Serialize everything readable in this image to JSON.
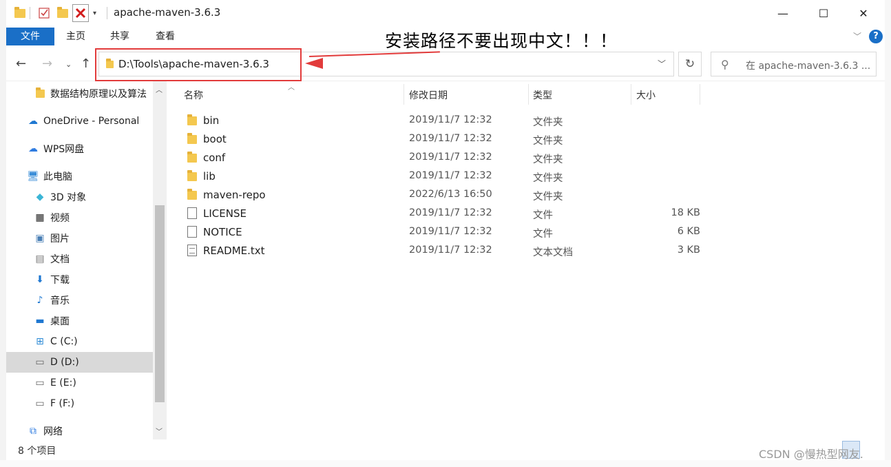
{
  "window": {
    "title": "apache-maven-3.6.3",
    "minimize": "—",
    "maximize": "☐",
    "close": "✕"
  },
  "ribbon": {
    "tabs": [
      "文件",
      "主页",
      "共享",
      "查看"
    ],
    "help": "?"
  },
  "annotation": {
    "text": "安装路径不要出现中文！！！",
    "color": "#e23b3b"
  },
  "address": {
    "path": "D:\\Tools\\apache-maven-3.6.3",
    "refresh": "↻",
    "search_placeholder": "在 apache-maven-3.6.3 ..."
  },
  "sidebar": {
    "items": [
      {
        "label": "数据结构原理以及算法",
        "icon": "folder-icon",
        "indent": 2,
        "selected": false
      },
      {
        "label": "OneDrive - Personal",
        "icon": "cloud-icon",
        "indent": 1,
        "selected": false
      },
      {
        "label": "WPS网盘",
        "icon": "cloud-icon",
        "indent": 1,
        "selected": false
      },
      {
        "label": "此电脑",
        "icon": "computer-icon",
        "indent": 1,
        "selected": false
      },
      {
        "label": "3D 对象",
        "icon": "cube-icon",
        "indent": 2,
        "selected": false
      },
      {
        "label": "视频",
        "icon": "video-icon",
        "indent": 2,
        "selected": false
      },
      {
        "label": "图片",
        "icon": "picture-icon",
        "indent": 2,
        "selected": false
      },
      {
        "label": "文档",
        "icon": "document-icon",
        "indent": 2,
        "selected": false
      },
      {
        "label": "下载",
        "icon": "download-icon",
        "indent": 2,
        "selected": false
      },
      {
        "label": "音乐",
        "icon": "music-icon",
        "indent": 2,
        "selected": false
      },
      {
        "label": "桌面",
        "icon": "desktop-icon",
        "indent": 2,
        "selected": false
      },
      {
        "label": "C (C:)",
        "icon": "drive-icon",
        "indent": 2,
        "selected": false
      },
      {
        "label": "D (D:)",
        "icon": "drive-icon",
        "indent": 2,
        "selected": true
      },
      {
        "label": "E (E:)",
        "icon": "drive-icon",
        "indent": 2,
        "selected": false
      },
      {
        "label": "F (F:)",
        "icon": "drive-icon",
        "indent": 2,
        "selected": false
      },
      {
        "label": "网络",
        "icon": "network-icon",
        "indent": 1,
        "selected": false
      }
    ]
  },
  "columns": {
    "name": "名称",
    "date": "修改日期",
    "type": "类型",
    "size": "大小"
  },
  "files": [
    {
      "name": "bin",
      "date": "2019/11/7 12:32",
      "type": "文件夹",
      "size": "",
      "icon": "folder-icon"
    },
    {
      "name": "boot",
      "date": "2019/11/7 12:32",
      "type": "文件夹",
      "size": "",
      "icon": "folder-icon"
    },
    {
      "name": "conf",
      "date": "2019/11/7 12:32",
      "type": "文件夹",
      "size": "",
      "icon": "folder-icon"
    },
    {
      "name": "lib",
      "date": "2019/11/7 12:32",
      "type": "文件夹",
      "size": "",
      "icon": "folder-icon"
    },
    {
      "name": "maven-repo",
      "date": "2022/6/13 16:50",
      "type": "文件夹",
      "size": "",
      "icon": "folder-icon"
    },
    {
      "name": "LICENSE",
      "date": "2019/11/7 12:32",
      "type": "文件",
      "size": "18 KB",
      "icon": "file-icon"
    },
    {
      "name": "NOTICE",
      "date": "2019/11/7 12:32",
      "type": "文件",
      "size": "6 KB",
      "icon": "file-icon"
    },
    {
      "name": "README.txt",
      "date": "2019/11/7 12:32",
      "type": "文本文档",
      "size": "3 KB",
      "icon": "text-file-icon"
    }
  ],
  "status": {
    "count": "8 个项目"
  },
  "watermark": "CSDN @慢热型网友."
}
